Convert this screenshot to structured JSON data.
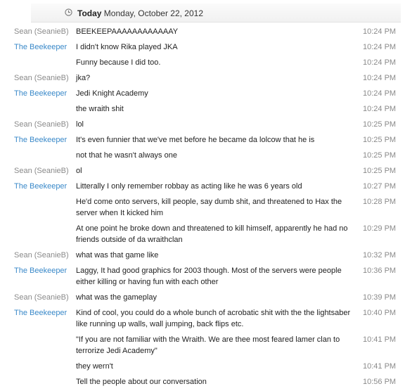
{
  "date_header": {
    "today_label": "Today",
    "date": "Monday, October 22, 2012"
  },
  "messages": [
    {
      "sender": "Sean (SeanieB)",
      "text": "BEEKEEPAAAAAAAAAAAAY",
      "time": "10:24 PM"
    },
    {
      "sender": "The Beekeeper",
      "text": "I didn't know Rika played JKA",
      "time": "10:24 PM"
    },
    {
      "sender": "",
      "text": "Funny because I did too.",
      "time": "10:24 PM"
    },
    {
      "sender": "Sean (SeanieB)",
      "text": "jka?",
      "time": "10:24 PM"
    },
    {
      "sender": "The Beekeeper",
      "text": "Jedi Knight Academy",
      "time": "10:24 PM"
    },
    {
      "sender": "",
      "text": "the wraith shit",
      "time": "10:24 PM"
    },
    {
      "sender": "Sean (SeanieB)",
      "text": "lol",
      "time": "10:25 PM"
    },
    {
      "sender": "The Beekeeper",
      "text": "It's even funnier that we've met before he became da lolcow that he is",
      "time": "10:25 PM"
    },
    {
      "sender": "",
      "text": "not that he wasn't always one",
      "time": "10:25 PM"
    },
    {
      "sender": "Sean (SeanieB)",
      "text": "ol",
      "time": "10:25 PM"
    },
    {
      "sender": "The Beekeeper",
      "text": "Litterally I only remember robbay as acting like he was 6 years old",
      "time": "10:27 PM"
    },
    {
      "sender": "",
      "text": "He'd come onto servers, kill people, say dumb shit, and threatened to Hax the server when It kicked him",
      "time": "10:28 PM"
    },
    {
      "sender": "",
      "text": "At one point he broke down and threatened to kill himself, apparently he had no friends outside of da wraithclan",
      "time": "10:29 PM"
    },
    {
      "sender": "Sean (SeanieB)",
      "text": "what was that game like",
      "time": "10:32 PM"
    },
    {
      "sender": "The Beekeeper",
      "text": "Laggy, It had good graphics for 2003 though. Most of the servers were people either killing or having fun with each other",
      "time": "10:36 PM"
    },
    {
      "sender": "Sean (SeanieB)",
      "text": "what was the gameplay",
      "time": "10:39 PM"
    },
    {
      "sender": "The Beekeeper",
      "text": "Kind of cool, you could do a whole bunch of acrobatic shit with the the lightsaber like running up walls, wall jumping, back flips etc.",
      "time": "10:40 PM"
    },
    {
      "sender": "",
      "text": "\"If you are not familiar with the Wraith. We are thee most feared lamer clan to terrorize Jedi Academy\"",
      "time": "10:41 PM"
    },
    {
      "sender": "",
      "text": "they wern't",
      "time": "10:41 PM"
    },
    {
      "sender": "",
      "text": "Tell the people about our conversation",
      "time": "10:56 PM"
    }
  ]
}
